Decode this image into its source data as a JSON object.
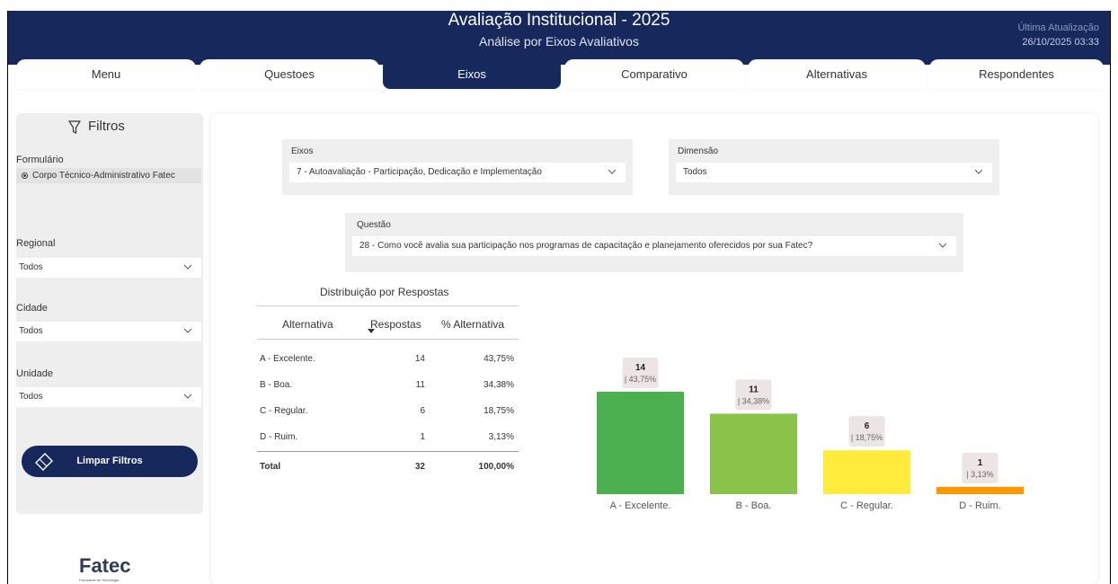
{
  "header": {
    "title": "Avaliação Institucional - 2025",
    "subtitle": "Análise por Eixos Avaliativos",
    "update_label": "Última Atualização",
    "update_value": "26/10/2025 03:33",
    "bg_color": "#16285c"
  },
  "tabs": [
    {
      "label": "Menu",
      "active": false
    },
    {
      "label": "Questoes",
      "active": false
    },
    {
      "label": "Eixos",
      "active": true
    },
    {
      "label": "Comparativo",
      "active": false
    },
    {
      "label": "Alternativas",
      "active": false
    },
    {
      "label": "Respondentes",
      "active": false
    }
  ],
  "sidebar": {
    "title": "Filtros",
    "formulario_label": "Formulário",
    "formulario_option": "Corpo Técnico-Administrativo Fatec",
    "regional_label": "Regional",
    "regional_value": "Todos",
    "cidade_label": "Cidade",
    "cidade_value": "Todos",
    "unidade_label": "Unidade",
    "unidade_value": "Todos",
    "clear_button": "Limpar Filtros"
  },
  "logo": {
    "text": "Fatec",
    "sub": "Faculdade de Tecnologia"
  },
  "slicers": {
    "eixos_label": "Eixos",
    "eixos_value": "7 - Autoavaliação - Participação, Dedicação e Implementação",
    "dimensao_label": "Dimensão",
    "dimensao_value": "Todos",
    "questao_label": "Questão",
    "questao_value": "28 - Como você avalia sua participação nos programas de capacitação e planejamento oferecidos por sua Fatec?"
  },
  "table": {
    "title": "Distribuição por Respostas",
    "headers": [
      "Alternativa",
      "Respostas",
      "% Alternativa"
    ],
    "rows": [
      {
        "alt": "A - Excelente.",
        "resp": "14",
        "pct": "43,75%"
      },
      {
        "alt": "B - Boa.",
        "resp": "11",
        "pct": "34,38%"
      },
      {
        "alt": "C - Regular.",
        "resp": "6",
        "pct": "18,75%"
      },
      {
        "alt": "D - Ruim.",
        "resp": "1",
        "pct": "3,13%"
      }
    ],
    "total": {
      "alt": "Total",
      "resp": "32",
      "pct": "100,00%"
    }
  },
  "chart_data": {
    "type": "bar",
    "categories": [
      "A - Excelente.",
      "B - Boa.",
      "C - Regular.",
      "D - Ruim."
    ],
    "values": [
      14,
      11,
      6,
      1
    ],
    "labels_pct": [
      "| 43,75%",
      "| 34,38%",
      "| 18,75%",
      "| 3,13%"
    ],
    "colors": [
      "#4caf50",
      "#8bc34a",
      "#ffeb3b",
      "#ff9800"
    ],
    "ylim": [
      0,
      14
    ]
  }
}
